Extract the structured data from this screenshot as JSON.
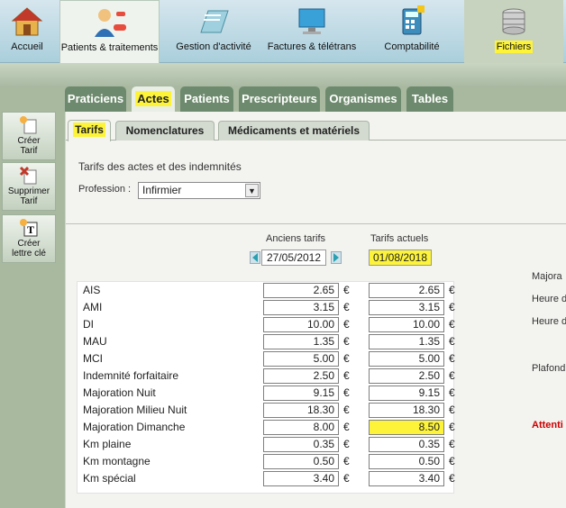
{
  "nav": [
    {
      "label": "Accueil",
      "icon": "house-icon"
    },
    {
      "label": "Patients & traitements",
      "icon": "patients-icon"
    },
    {
      "label": "Gestion d'activité",
      "icon": "folder-icon"
    },
    {
      "label": "Factures & télétrans",
      "icon": "computer-icon"
    },
    {
      "label": "Comptabilité",
      "icon": "calculator-icon"
    },
    {
      "label": "Fichiers",
      "icon": "database-icon"
    }
  ],
  "main_tabs": [
    "Praticiens",
    "Actes",
    "Patients",
    "Prescripteurs",
    "Organismes",
    "Tables"
  ],
  "side_buttons": [
    {
      "label1": "Créer",
      "label2": "Tarif"
    },
    {
      "label1": "Supprimer",
      "label2": "Tarif"
    },
    {
      "label1": "Créer",
      "label2": "lettre clé"
    }
  ],
  "sub_tabs": [
    "Tarifs",
    "Nomenclatures",
    "Médicaments et matériels"
  ],
  "section_title": "Tarifs des actes et des indemnités",
  "profession_label": "Profession :",
  "profession_value": "Infirmier",
  "old_header": "Anciens tarifs",
  "new_header": "Tarifs actuels",
  "old_date": "27/05/2012",
  "new_date": "01/08/2018",
  "currency": "€",
  "rows": [
    {
      "name": "AIS",
      "old": "2.65",
      "new": "2.65"
    },
    {
      "name": "AMI",
      "old": "3.15",
      "new": "3.15"
    },
    {
      "name": "DI",
      "old": "10.00",
      "new": "10.00"
    },
    {
      "name": "MAU",
      "old": "1.35",
      "new": "1.35"
    },
    {
      "name": "MCI",
      "old": "5.00",
      "new": "5.00"
    },
    {
      "name": "Indemnité forfaitaire",
      "old": "2.50",
      "new": "2.50"
    },
    {
      "name": "Majoration Nuit",
      "old": "9.15",
      "new": "9.15"
    },
    {
      "name": "Majoration Milieu Nuit",
      "old": "18.30",
      "new": "18.30"
    },
    {
      "name": "Majoration Dimanche",
      "old": "8.00",
      "new": "8.50"
    },
    {
      "name": "Km plaine",
      "old": "0.35",
      "new": "0.35"
    },
    {
      "name": "Km montagne",
      "old": "0.50",
      "new": "0.50"
    },
    {
      "name": "Km spécial",
      "old": "3.40",
      "new": "3.40"
    }
  ],
  "right_labels": [
    "Majora",
    "Heure d",
    "Heure d",
    "Plafond"
  ],
  "attention": "Attenti",
  "colors": {
    "highlight": "#fdf43a",
    "tab_green": "#6e8a6e",
    "alert": "#cc0000"
  }
}
